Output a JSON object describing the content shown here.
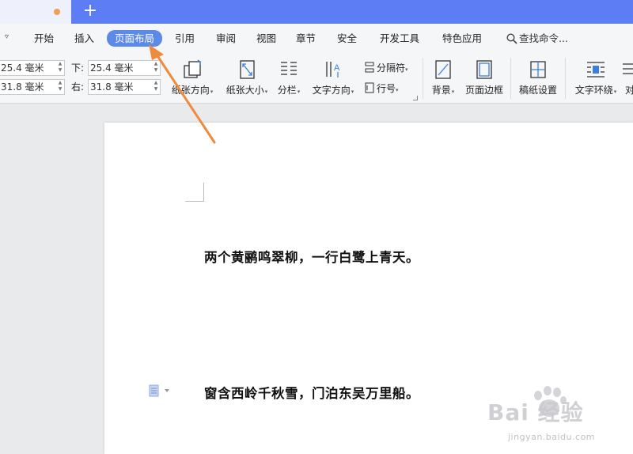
{
  "menu": {
    "tabs": [
      "开始",
      "插入",
      "页面布局",
      "引用",
      "审阅",
      "视图",
      "章节",
      "安全",
      "开发工具",
      "特色应用"
    ],
    "active_tab": "页面布局",
    "search_label": "查找命令..."
  },
  "ribbon": {
    "margins": {
      "top_value": "25.4 毫米",
      "left_value": "31.8 毫米",
      "bottom_label": "下:",
      "bottom_value": "25.4 毫米",
      "right_label": "右:",
      "right_value": "31.8 毫米"
    },
    "buttons": {
      "orientation": "纸张方向",
      "paper_size": "纸张大小",
      "columns": "分栏",
      "text_direction": "文字方向",
      "separator": "分隔符",
      "line_number": "行号",
      "background": "背景",
      "page_border": "页面边框",
      "manuscript": "稿纸设置",
      "text_wrap": "文字环绕",
      "align_partial": "对"
    }
  },
  "document": {
    "lines": [
      "两个黄鹂鸣翠柳，一行白鹭上青天。",
      "窗含西岭千秋雪，门泊东吴万里船。"
    ]
  },
  "watermark": {
    "brand": "Bai 经验",
    "site": "jingyan.baidu.com"
  },
  "colors": {
    "titlebar": "#5d7df5",
    "active_tab": "#5b8ae8",
    "arrow": "#f08a3c"
  }
}
